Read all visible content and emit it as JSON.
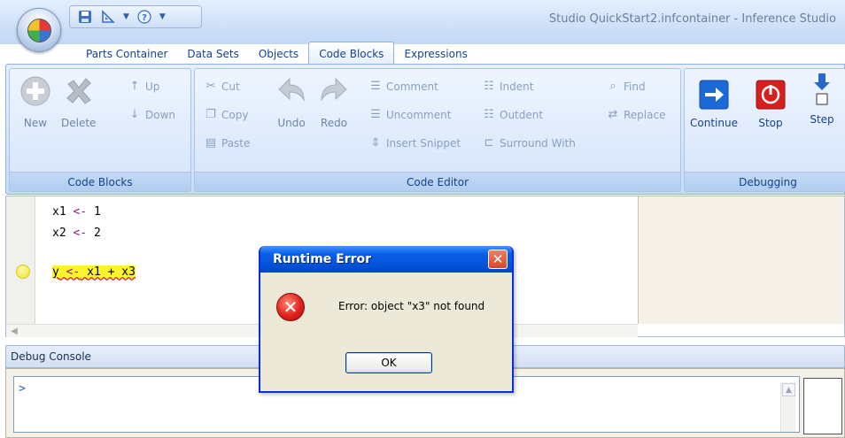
{
  "window": {
    "title": "Studio QuickStart2.infcontainer - Inference Studio"
  },
  "tabs": [
    "Parts Container",
    "Data Sets",
    "Objects",
    "Code Blocks",
    "Expressions"
  ],
  "active_tab": "Code Blocks",
  "ribbon": {
    "code_blocks": {
      "label": "Code Blocks",
      "new": "New",
      "delete": "Delete",
      "up": "Up",
      "down": "Down"
    },
    "code_editor": {
      "label": "Code Editor",
      "cut": "Cut",
      "copy": "Copy",
      "paste": "Paste",
      "undo": "Undo",
      "redo": "Redo",
      "comment": "Comment",
      "uncomment": "Uncomment",
      "insert_snippet": "Insert Snippet",
      "indent": "Indent",
      "outdent": "Outdent",
      "surround_with": "Surround With",
      "find": "Find",
      "replace": "Replace"
    },
    "debugging": {
      "label": "Debugging",
      "continue": "Continue",
      "stop": "Stop",
      "step": "Step"
    }
  },
  "editor": {
    "lines": [
      {
        "lhs": "x1",
        "op": "<-",
        "rhs": "1"
      },
      {
        "lhs": "x2",
        "op": "<-",
        "rhs": "2"
      },
      {
        "lhs": "y",
        "op": "<-",
        "rhs": "x1 + x3"
      }
    ]
  },
  "console": {
    "title": "Debug Console",
    "prompt": ">"
  },
  "dialog": {
    "title": "Runtime Error",
    "message": "Error: object \"x3\" not found",
    "ok": "OK"
  },
  "colors": {
    "accent": "#15428b",
    "dialog_title": "#0553db",
    "highlight": "#fbf32c",
    "error": "#e0211b"
  }
}
